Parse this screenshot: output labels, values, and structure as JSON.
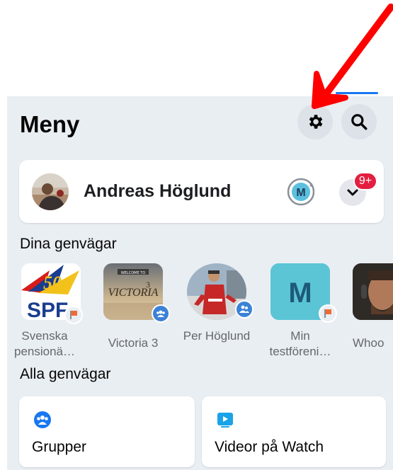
{
  "menu": {
    "title": "Meny",
    "settings_icon": "gear-icon",
    "search_icon": "search-icon"
  },
  "profile": {
    "name": "Andreas Höglund",
    "switch_account_initial": "M",
    "notification_badge": "9+"
  },
  "shortcuts_section": {
    "title": "Dina genvägar",
    "items": [
      {
        "label": "Svenska pensionä…",
        "badge_icon": "flag-icon",
        "logo_text": "SPF",
        "logo_badge": "50 ÅR"
      },
      {
        "label": "Victoria 3",
        "badge_icon": "group-icon",
        "logo_text": "VICTORIA",
        "logo_top": "WELCOME TO",
        "logo_number": "3"
      },
      {
        "label": "Per Höglund",
        "badge_icon": "friends-icon"
      },
      {
        "label": "Min testföreni…",
        "badge_icon": "flag-icon",
        "logo_text": "M"
      },
      {
        "label": "Whoo",
        "badge_icon": ""
      }
    ]
  },
  "all_shortcuts": {
    "title": "Alla genvägar",
    "tiles": [
      {
        "label": "Grupper",
        "icon": "groups-icon"
      },
      {
        "label": "Videor på Watch",
        "icon": "watch-icon"
      }
    ]
  },
  "colors": {
    "accent": "#1877f2",
    "arrow": "#ff0000",
    "badge": "#e41e3f",
    "panel_bg": "#e9eef3"
  }
}
